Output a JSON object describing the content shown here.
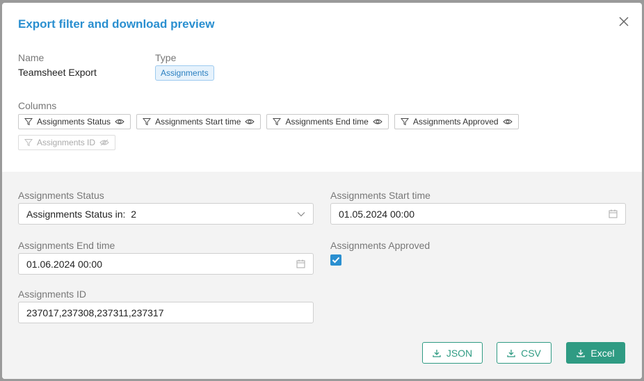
{
  "dialog": {
    "title": "Export filter and download preview",
    "close_icon": "close-icon"
  },
  "meta": {
    "name_label": "Name",
    "name_value": "Teamsheet Export",
    "type_label": "Type",
    "type_value": "Assignments"
  },
  "columns": {
    "label": "Columns",
    "items": [
      {
        "label": "Assignments Status",
        "visible": true
      },
      {
        "label": "Assignments Start time",
        "visible": true
      },
      {
        "label": "Assignments End time",
        "visible": true
      },
      {
        "label": "Assignments Approved",
        "visible": true
      },
      {
        "label": "Assignments ID",
        "visible": false
      }
    ]
  },
  "filters": {
    "status": {
      "label": "Assignments Status",
      "prefix": "Assignments Status in:",
      "count": "2"
    },
    "start": {
      "label": "Assignments Start time",
      "value": "01.05.2024 00:00"
    },
    "end": {
      "label": "Assignments End time",
      "value": "01.06.2024 00:00"
    },
    "approved": {
      "label": "Assignments Approved",
      "checked": true
    },
    "id": {
      "label": "Assignments ID",
      "value": "237017,237308,237311,237317"
    }
  },
  "actions": {
    "json_label": "JSON",
    "csv_label": "CSV",
    "excel_label": "Excel"
  },
  "colors": {
    "accent": "#2a8fd0",
    "primary_button": "#2f9b83"
  }
}
